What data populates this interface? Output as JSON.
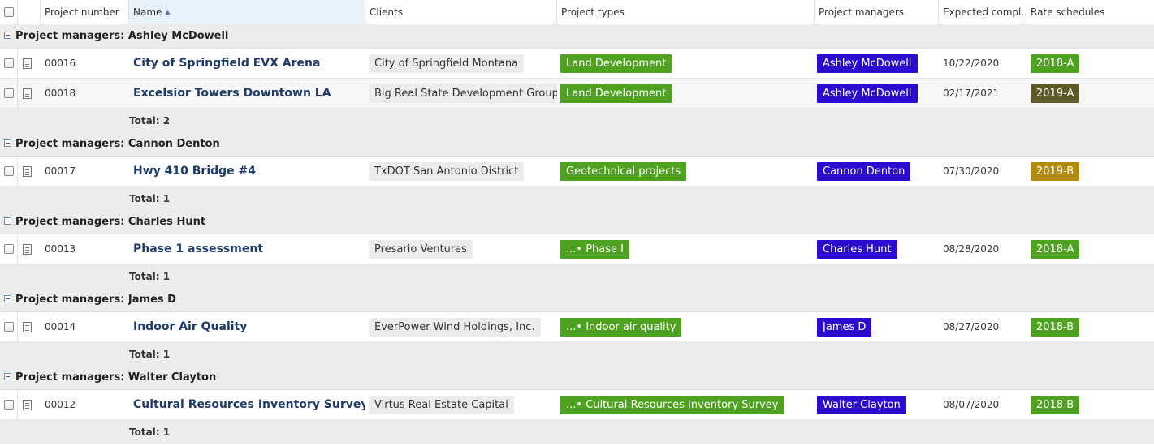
{
  "columns": {
    "project_number": "Project number",
    "name": "Name",
    "clients": "Clients",
    "project_types": "Project types",
    "project_managers": "Project managers",
    "expected_completion": "Expected compl...",
    "rate_schedules": "Rate schedules"
  },
  "sort_icon": "sort-ascending-icon",
  "colors": {
    "type_tag": "#4ea21f",
    "pm_tag": "#2a0bcf",
    "rate_2018A": "#4ea21f",
    "rate_2019A": "#5e5a28",
    "rate_2019B": "#b38b0b",
    "rate_2018B": "#4ea21f"
  },
  "groups": [
    {
      "label": "Project managers: Ashley McDowell",
      "total": "Total: 2",
      "rows": [
        {
          "number": "00016",
          "name": "City of Springfield EVX Arena",
          "client": "City of Springfield Montana",
          "type": "Land Development",
          "pm": "Ashley McDowell",
          "date": "10/22/2020",
          "rate": "2018-A",
          "rate_color": "#4ea21f"
        },
        {
          "number": "00018",
          "name": "Excelsior Towers Downtown LA",
          "client": "Big Real State Development Group",
          "type": "Land Development",
          "pm": "Ashley McDowell",
          "date": "02/17/2021",
          "rate": "2019-A",
          "rate_color": "#5e5a28"
        }
      ]
    },
    {
      "label": "Project managers: Cannon Denton",
      "total": "Total: 1",
      "rows": [
        {
          "number": "00017",
          "name": "Hwy 410 Bridge #4",
          "client": "TxDOT San Antonio District",
          "type": "Geotechnical projects",
          "pm": "Cannon Denton",
          "date": "07/30/2020",
          "rate": "2019-B",
          "rate_color": "#b38b0b"
        }
      ]
    },
    {
      "label": "Project managers: Charles Hunt",
      "total": "Total: 1",
      "rows": [
        {
          "number": "00013",
          "name": "Phase 1 assessment",
          "client": "Presario Ventures",
          "type": "...• Phase I",
          "pm": "Charles Hunt",
          "date": "08/28/2020",
          "rate": "2018-A",
          "rate_color": "#4ea21f"
        }
      ]
    },
    {
      "label": "Project managers: James D",
      "total": "Total: 1",
      "rows": [
        {
          "number": "00014",
          "name": "Indoor Air Quality",
          "client": "EverPower Wind Holdings, Inc.",
          "type": "...• Indoor air quality",
          "pm": "James D",
          "date": "08/27/2020",
          "rate": "2018-B",
          "rate_color": "#4ea21f"
        }
      ]
    },
    {
      "label": "Project managers: Walter Clayton",
      "total": "Total: 1",
      "rows": [
        {
          "number": "00012",
          "name": "Cultural Resources Inventory Survey",
          "client": "Virtus Real Estate Capital",
          "type": "...• Cultural Resources Inventory Survey",
          "pm": "Walter Clayton",
          "date": "08/07/2020",
          "rate": "2018-B",
          "rate_color": "#4ea21f"
        }
      ]
    }
  ]
}
